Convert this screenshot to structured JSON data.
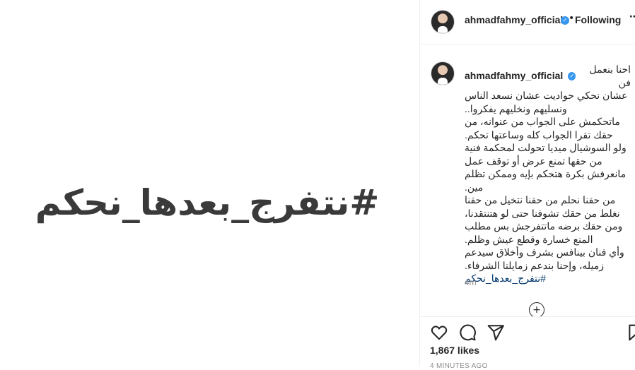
{
  "post": {
    "image_text": "#نتفرج_بعدها_نحكم"
  },
  "header": {
    "username": "ahmadfahmy_official",
    "separator": "•",
    "follow_status": "Following",
    "more": "..."
  },
  "caption": {
    "username": "ahmadfahmy_official",
    "first": "احنا بنعمل فن",
    "lines": [
      "عشان نحكي حواديت عشان نسعد الناس",
      "ونسليهم ونخليهم يفكروا..",
      "ماتحكمش على الجواب من عنوانه، من",
      "حقك تقرا الجواب كله وساعتها تحكم.",
      "ولو السوشيال ميديا تحولت لمحكمة فنية",
      "من حقها تمنع عرض أو توقف عمل",
      "مانعرفش بكرة هتحكم بإيه وممكن تظلم",
      "مين.",
      "من حقنا نحلم من حقنا نتخيل من حقنا",
      "نغلط من حقك تشوفنا حتى لو هتنتقدنا،",
      "ومن حقك برضه ماتتفرجش بس مطلب",
      "المنع خسارة وقطع عيش وظلم.",
      "وأي فنان بينافس بشرف وأخلاق سيدعم",
      "زميله، وإحنا بندعم زمايلنا الشرفاء."
    ],
    "hashtag": "#نتفرج_بعدها_نحكم",
    "time": "4m"
  },
  "engagement": {
    "likes": "1,867 likes",
    "ago": "4 MINUTES AGO"
  },
  "colors": {
    "verified": "#3897f0",
    "link": "#00376b",
    "muted": "#8e8e8e"
  }
}
